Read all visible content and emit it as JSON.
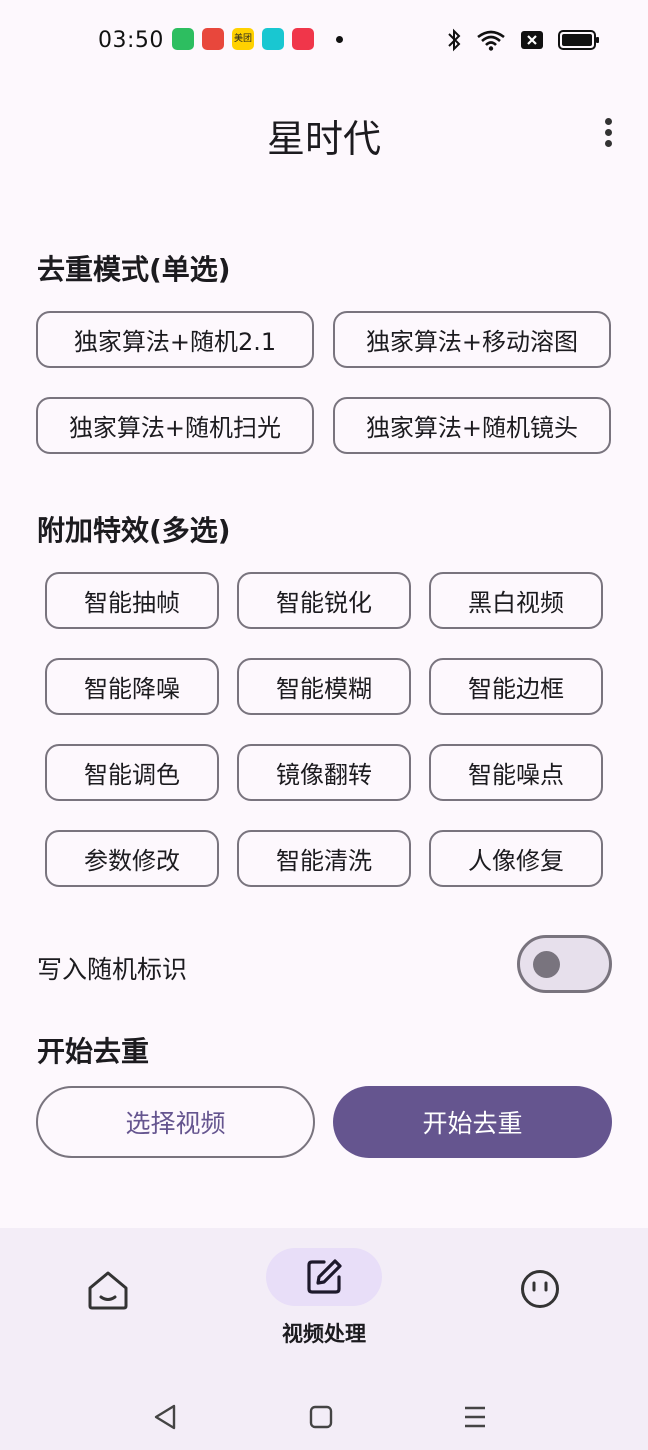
{
  "status_bar": {
    "time": "03:50",
    "notification_badge": "美团"
  },
  "app_bar": {
    "title": "星时代"
  },
  "mode_section": {
    "title": "去重模式(单选)",
    "options": [
      "独家算法+随机2.1",
      "独家算法+移动溶图",
      "独家算法+随机扫光",
      "独家算法+随机镜头"
    ]
  },
  "effects_section": {
    "title": "附加特效(多选)",
    "options": [
      "智能抽帧",
      "智能锐化",
      "黑白视频",
      "智能降噪",
      "智能模糊",
      "智能边框",
      "智能调色",
      "镜像翻转",
      "智能噪点",
      "参数修改",
      "智能清洗",
      "人像修复"
    ]
  },
  "random_tag": {
    "label": "写入随机标识",
    "enabled": false
  },
  "start_section": {
    "title": "开始去重",
    "select_video_label": "选择视频",
    "start_label": "开始去重"
  },
  "bottom_nav": {
    "items": [
      {
        "icon": "home-icon",
        "label": ""
      },
      {
        "icon": "edit-icon",
        "label": "视频处理",
        "selected": true
      },
      {
        "icon": "face-icon",
        "label": ""
      }
    ]
  },
  "colors": {
    "primary": "#65558F",
    "background": "#FDF8FD",
    "outline": "#79747E",
    "nav_background": "#F3EDF7",
    "nav_indicator": "#E8DEF8"
  }
}
